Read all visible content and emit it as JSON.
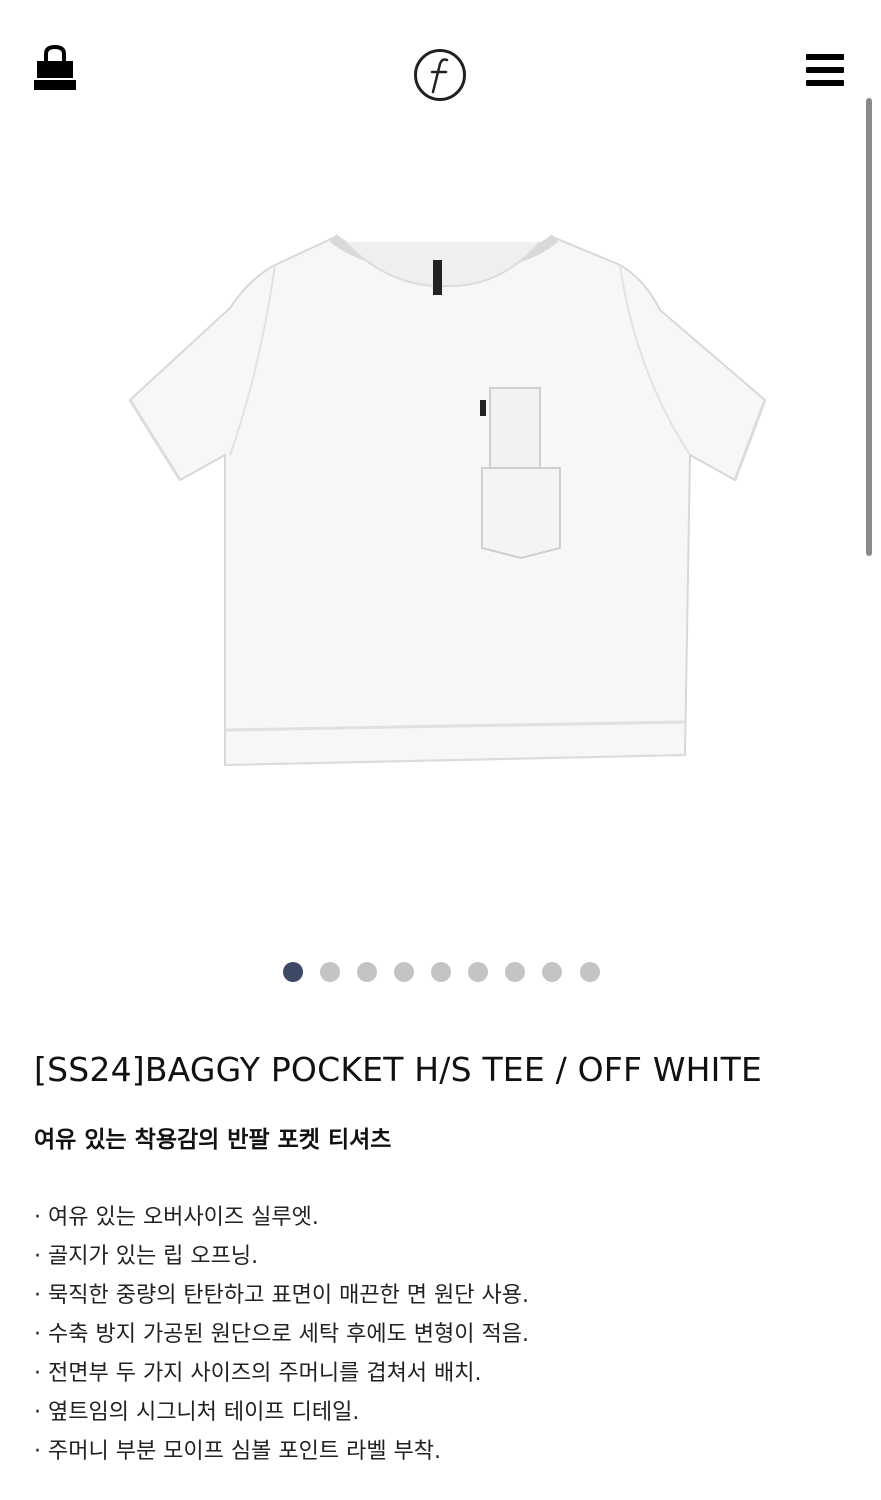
{
  "header": {
    "cart_icon": "shopping-bag-icon",
    "logo_icon": "circled-f-logo",
    "menu_icon": "hamburger-menu-icon"
  },
  "gallery": {
    "image_alt": "white short-sleeve t-shirt with layered chest pockets",
    "slide_count": 9,
    "active_slide": 1,
    "active_dot_color": "#3d4766",
    "inactive_dot_color": "#c4c4c4"
  },
  "product": {
    "title": "[SS24]BAGGY POCKET H/S TEE / OFF WHITE",
    "subtitle": "여유 있는 착용감의 반팔 포켓 티셔츠",
    "features": [
      "여유 있는 오버사이즈 실루엣.",
      "골지가 있는 립 오프닝.",
      "묵직한 중량의 탄탄하고 표면이 매끈한 면 원단 사용.",
      "수축 방지 가공된 원단으로 세탁 후에도 변형이 적음.",
      "전면부 두 가지 사이즈의 주머니를 겹쳐서 배치.",
      "옆트임의 시그니처 테이프 디테일.",
      "주머니 부분 모이프 심볼 포인트 라벨 부착."
    ]
  }
}
